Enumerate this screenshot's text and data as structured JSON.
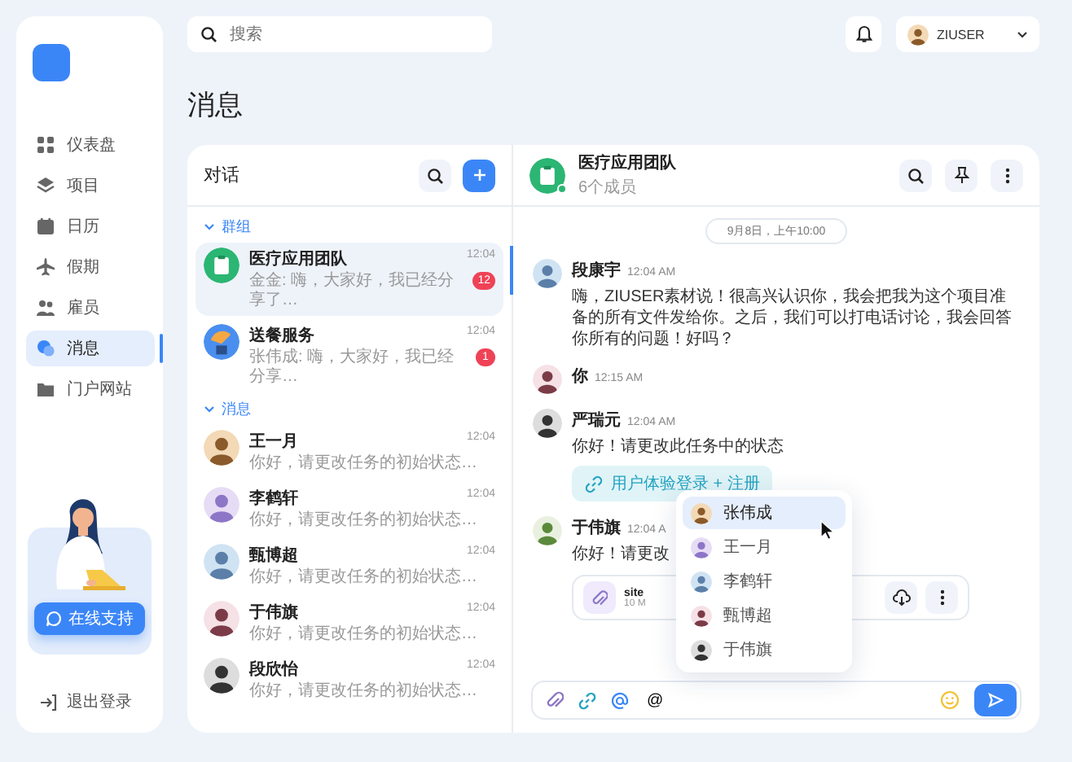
{
  "sidebar": {
    "nav": [
      {
        "label": "仪表盘",
        "selected": false
      },
      {
        "label": "项目",
        "selected": false
      },
      {
        "label": "日历",
        "selected": false
      },
      {
        "label": "假期",
        "selected": false
      },
      {
        "label": "雇员",
        "selected": false
      },
      {
        "label": "消息",
        "selected": true
      },
      {
        "label": "门户网站",
        "selected": false
      }
    ],
    "support_button": "在线支持",
    "logout": "退出登录"
  },
  "topbar": {
    "search_placeholder": "搜索",
    "user": "ZIUSER"
  },
  "page_title": "消息",
  "conversations": {
    "title": "对话",
    "sections": [
      {
        "label": "群组",
        "expanded": true,
        "items": [
          {
            "kind": "group",
            "name": "医疗应用团队",
            "time": "12:04",
            "preview": "金金: 嗨，大家好，我已经分享了…",
            "unread": "12",
            "selected": true
          },
          {
            "kind": "group",
            "name": "送餐服务",
            "time": "12:04",
            "preview": "张伟成: 嗨，大家好，我已经分享…",
            "unread": "1",
            "selected": false
          }
        ]
      },
      {
        "label": "消息",
        "expanded": true,
        "items": [
          {
            "kind": "person",
            "name": "王一月",
            "time": "12:04",
            "preview": "你好，请更改任务的初始状态…",
            "selected": false
          },
          {
            "kind": "person",
            "name": "李鹤轩",
            "time": "12:04",
            "preview": "你好，请更改任务的初始状态…",
            "selected": false
          },
          {
            "kind": "person",
            "name": "甄博超",
            "time": "12:04",
            "preview": "你好，请更改任务的初始状态…",
            "selected": false
          },
          {
            "kind": "person",
            "name": "于伟旗",
            "time": "12:04",
            "preview": "你好，请更改任务的初始状态…",
            "selected": false
          },
          {
            "kind": "person",
            "name": "段欣怡",
            "time": "12:04",
            "preview": "你好，请更改任务的初始状态…",
            "selected": false
          }
        ]
      }
    ]
  },
  "chat": {
    "title": "医疗应用团队",
    "subtitle": "6个成员",
    "online": true,
    "date": "9月8日，上午10:00",
    "messages": [
      {
        "sender": "段康宇",
        "time": "12:04 AM",
        "text": "嗨，ZIUSER素材说！很高兴认识你，我会把我为这个项目准备的所有文件发给你。之后，我们可以打电话讨论，我会回答你所有的问题！好吗？"
      },
      {
        "sender": "你",
        "time": "12:15 AM"
      },
      {
        "sender": "严瑞元",
        "time": "12:04 AM",
        "text": "你好！请更改此任务中的状态",
        "link": "用户体验登录 + 注册"
      },
      {
        "sender": "于伟旗",
        "time": "12:04 A",
        "text": "你好！请更改",
        "file": {
          "name": "site",
          "size": "10 M"
        }
      }
    ],
    "mention_menu": [
      {
        "name": "张伟成",
        "selected": true
      },
      {
        "name": "王一月",
        "selected": false
      },
      {
        "name": "李鹤轩",
        "selected": false
      },
      {
        "name": "甄博超",
        "selected": false
      },
      {
        "name": "于伟旗",
        "selected": false
      }
    ],
    "input": {
      "value": "@"
    }
  }
}
